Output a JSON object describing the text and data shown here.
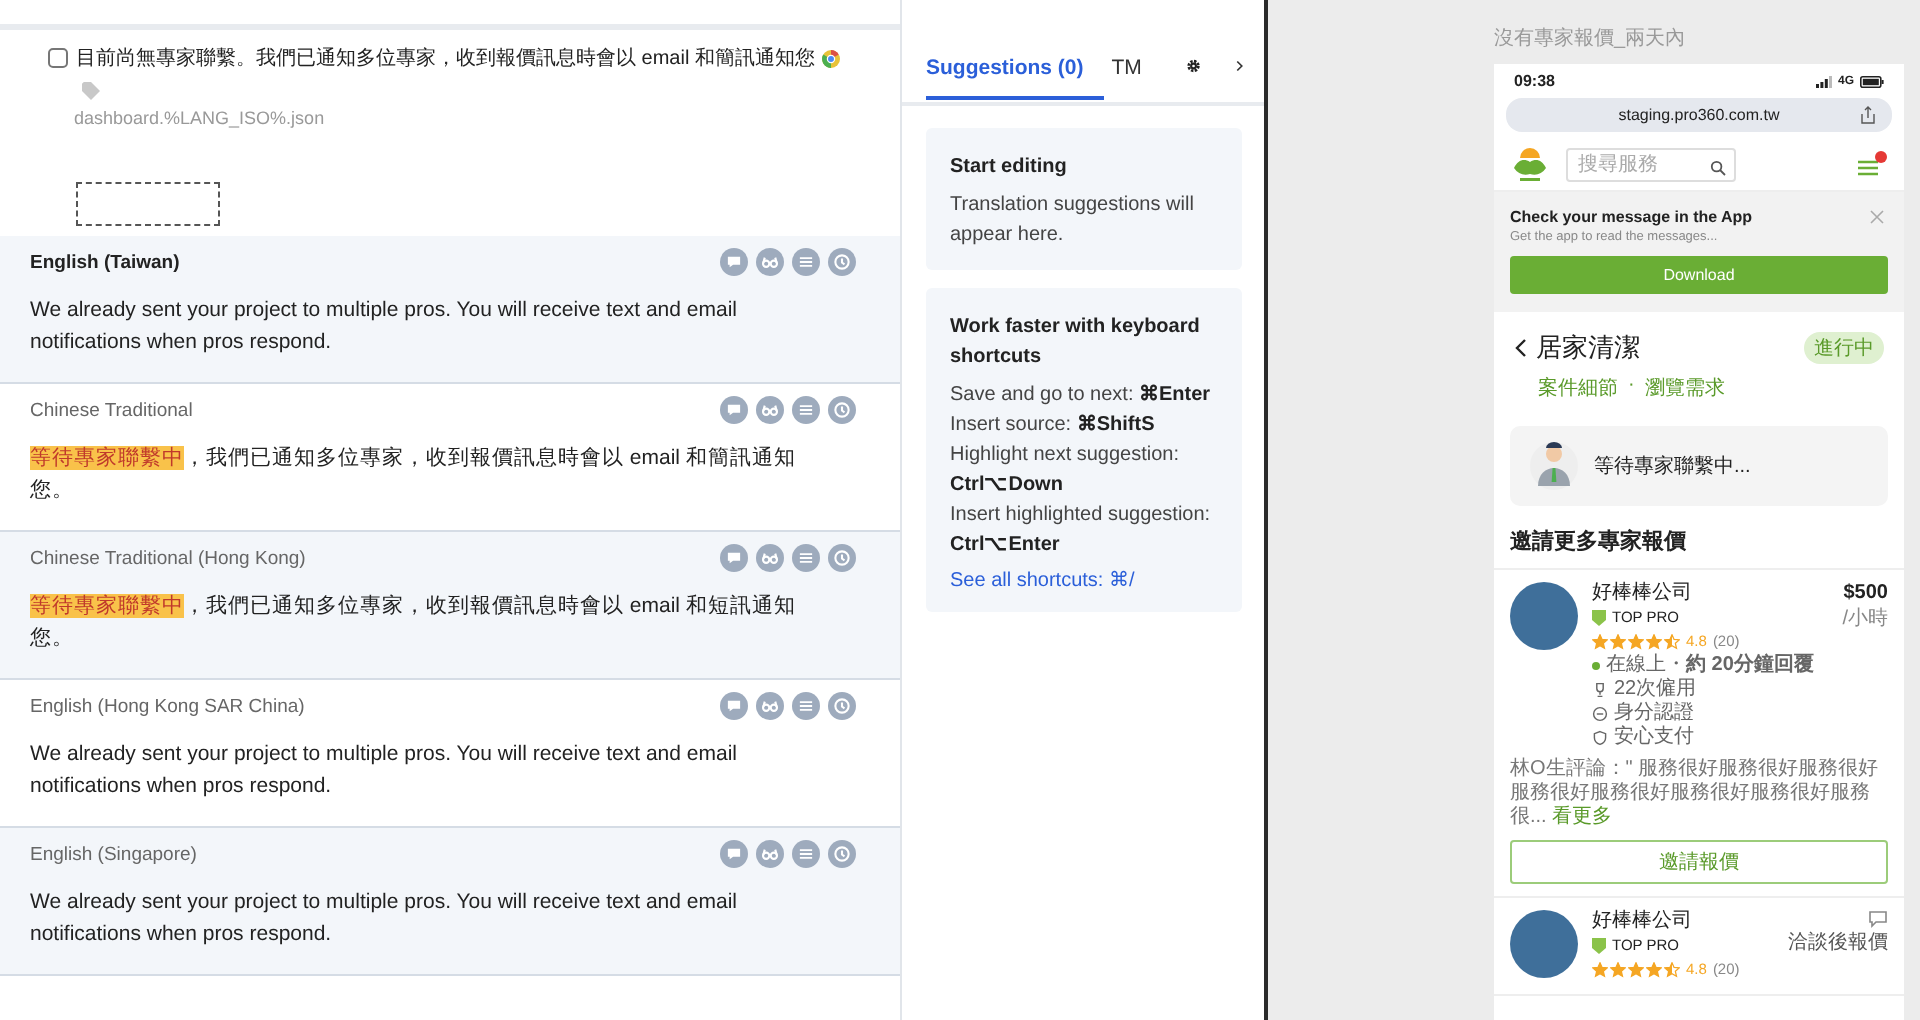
{
  "source": {
    "checked": false,
    "text": "目前尚無專家聯繫。我們已通知多位專家，收到報價訊息時會以 email 和簡訊通知您",
    "file": "dashboard.%LANG_ISO%.json"
  },
  "translations": [
    {
      "language": "English (Taiwan)",
      "selected": true,
      "text": "We already sent your project to multiple pros. You will receive text and email notifications when pros respond."
    },
    {
      "language": "Chinese Traditional",
      "selected": false,
      "highlight": "等待專家聯繫中",
      "text": "，我們已通知多位專家，收到報價訊息時會以 email 和簡訊通知您。"
    },
    {
      "language": "Chinese Traditional (Hong Kong)",
      "selected": false,
      "highlight": "等待專家聯繫中",
      "text": "，我們已通知多位專家，收到報價訊息時會以 email 和短訊通知您。"
    },
    {
      "language": "English (Hong Kong SAR China)",
      "selected": false,
      "text": "We already sent your project to multiple pros. You will receive text and email notifications when pros respond."
    },
    {
      "language": "English (Singapore)",
      "selected": false,
      "text": "We already sent your project to multiple pros. You will receive text and email notifications when pros respond."
    }
  ],
  "suggestions": {
    "tabs": [
      {
        "label": "Suggestions (0)",
        "selected": true
      },
      {
        "label": "TM",
        "selected": false
      }
    ],
    "cards": [
      {
        "title": "Start editing",
        "lines": [
          "Translation suggestions will appear here."
        ]
      },
      {
        "title": "Work faster with keyboard shortcuts",
        "lines": [
          "Save and go to next: **⌘Enter**",
          "Insert source: **⌘ShiftS**",
          "Highlight next suggestion: **Ctrl⌥Down**",
          "Insert highlighted suggestion: **Ctrl⌥Enter**"
        ],
        "link": "See all shortcuts: ⌘/"
      }
    ]
  },
  "mockup": {
    "caption": "沒有專家報價_兩天內",
    "time": "09:38",
    "network": "4G",
    "url": "staging.pro360.com.tw",
    "search_placeholder": "搜尋服務",
    "banner": {
      "title": "Check your message in the App",
      "subtitle": "Get the app to read the messages...",
      "button": "Download"
    },
    "project": {
      "title": "居家清潔",
      "status": "進行中",
      "links": [
        "案件細節",
        "瀏覽需求"
      ],
      "separator": "·"
    },
    "waiting": "等待專家聯繫中...",
    "heading": "邀請更多專家報價",
    "pros": [
      {
        "name": "好棒棒公司",
        "badge": "TOP PRO",
        "stars": 4.5,
        "rating": "4.8",
        "reviews": "(20)",
        "price": "$500",
        "unit": "/小時",
        "online": true,
        "status": "在線上・**約 20分鐘回覆**",
        "details": [
          {
            "kind": "hires",
            "text": "22次僱用"
          },
          {
            "kind": "identity",
            "text": "身分認證"
          },
          {
            "kind": "payment",
            "text": "安心支付"
          }
        ],
        "review": "林O生評論：\" 服務很好服務很好服務很好服務很好服務很好服務很好服務很好服務很...",
        "more": "看更多",
        "action": "邀請報價"
      },
      {
        "name": "好棒棒公司",
        "badge": "TOP PRO",
        "stars": 4.5,
        "rating": "4.8",
        "reviews": "(20)",
        "note": "洽談後報價"
      }
    ]
  }
}
